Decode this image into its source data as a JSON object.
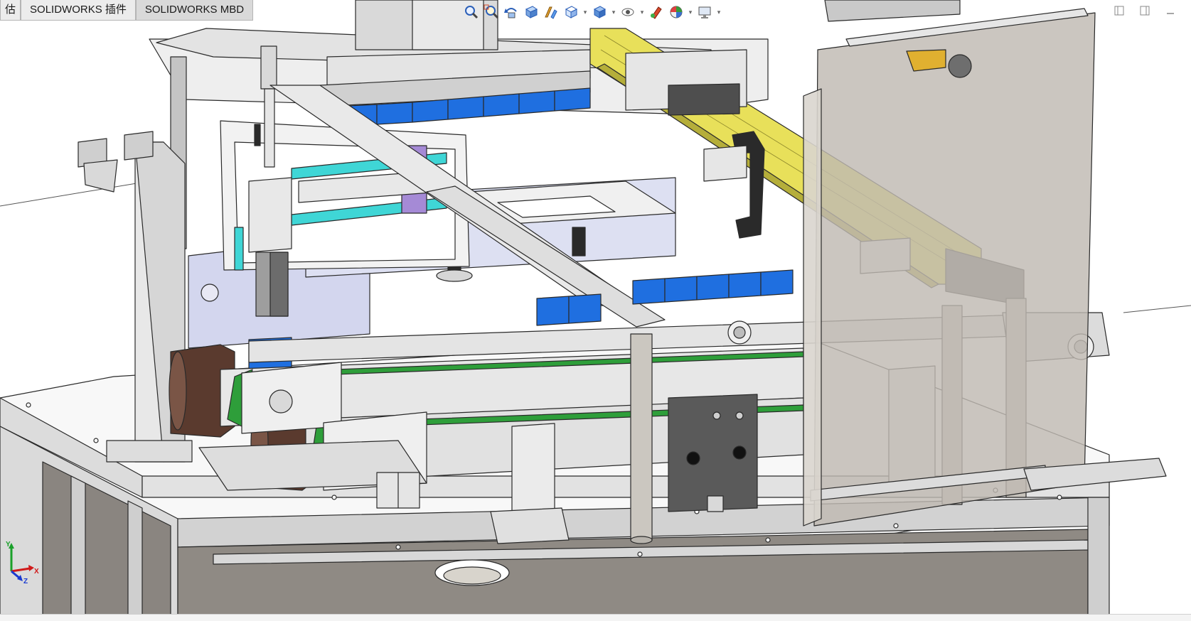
{
  "tabs": [
    {
      "label": "估",
      "active": false
    },
    {
      "label": "SOLIDWORKS 插件",
      "active": false
    },
    {
      "label": "SOLIDWORKS MBD",
      "active": true
    }
  ],
  "heads_up_toolbar": [
    {
      "icon": "zoom-to-fit-icon"
    },
    {
      "icon": "zoom-to-area-icon"
    },
    {
      "icon": "previous-view-icon"
    },
    {
      "icon": "section-view-icon"
    },
    {
      "icon": "dynamic-annotation-views-icon"
    },
    {
      "icon": "view-orientation-icon",
      "dropdown": true
    },
    {
      "icon": "display-style-icon",
      "dropdown": true
    },
    {
      "icon": "hide-show-items-icon",
      "dropdown": true
    },
    {
      "icon": "edit-appearance-icon"
    },
    {
      "icon": "apply-scene-icon",
      "dropdown": true
    },
    {
      "icon": "view-settings-icon",
      "dropdown": true
    }
  ],
  "window_controls": [
    {
      "icon": "tile-left-icon"
    },
    {
      "icon": "tile-right-icon"
    },
    {
      "icon": "minimize-icon"
    }
  ],
  "triad": {
    "x": "X",
    "y": "Y",
    "z": "Z"
  },
  "colors": {
    "rail_cyan": "#3fd6d6",
    "block_blue": "#1f6fe0",
    "chain_yellow": "#e8e05a",
    "belt_green": "#2e9e3a",
    "motor_brown": "#5a3a2e",
    "metal_light": "#e6e6e6",
    "metal_mid": "#c9c9c9",
    "metal_dark": "#5a5a5a",
    "guard_glass": "#bfbab2",
    "lavender": "#d3d6ee",
    "outline": "#2a2a2a"
  }
}
